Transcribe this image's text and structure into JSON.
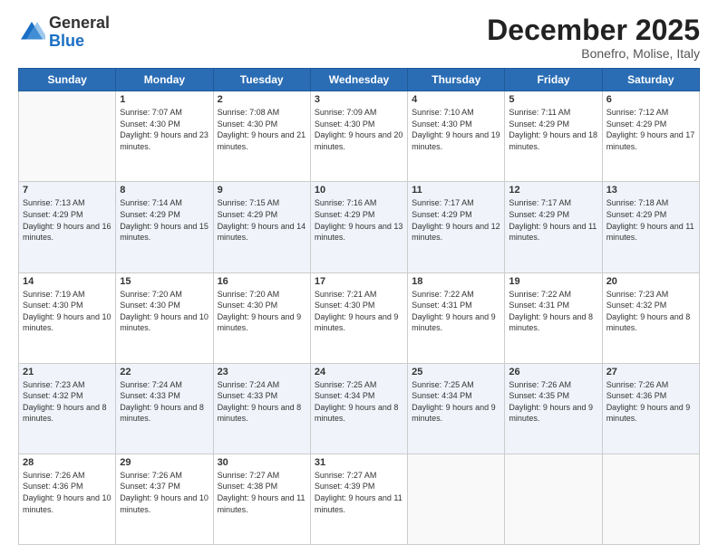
{
  "logo": {
    "general": "General",
    "blue": "Blue"
  },
  "header": {
    "month": "December 2025",
    "location": "Bonefro, Molise, Italy"
  },
  "weekdays": [
    "Sunday",
    "Monday",
    "Tuesday",
    "Wednesday",
    "Thursday",
    "Friday",
    "Saturday"
  ],
  "weeks": [
    [
      {
        "day": "",
        "sunrise": "",
        "sunset": "",
        "daylight": ""
      },
      {
        "day": "1",
        "sunrise": "Sunrise: 7:07 AM",
        "sunset": "Sunset: 4:30 PM",
        "daylight": "Daylight: 9 hours and 23 minutes."
      },
      {
        "day": "2",
        "sunrise": "Sunrise: 7:08 AM",
        "sunset": "Sunset: 4:30 PM",
        "daylight": "Daylight: 9 hours and 21 minutes."
      },
      {
        "day": "3",
        "sunrise": "Sunrise: 7:09 AM",
        "sunset": "Sunset: 4:30 PM",
        "daylight": "Daylight: 9 hours and 20 minutes."
      },
      {
        "day": "4",
        "sunrise": "Sunrise: 7:10 AM",
        "sunset": "Sunset: 4:30 PM",
        "daylight": "Daylight: 9 hours and 19 minutes."
      },
      {
        "day": "5",
        "sunrise": "Sunrise: 7:11 AM",
        "sunset": "Sunset: 4:29 PM",
        "daylight": "Daylight: 9 hours and 18 minutes."
      },
      {
        "day": "6",
        "sunrise": "Sunrise: 7:12 AM",
        "sunset": "Sunset: 4:29 PM",
        "daylight": "Daylight: 9 hours and 17 minutes."
      }
    ],
    [
      {
        "day": "7",
        "sunrise": "Sunrise: 7:13 AM",
        "sunset": "Sunset: 4:29 PM",
        "daylight": "Daylight: 9 hours and 16 minutes."
      },
      {
        "day": "8",
        "sunrise": "Sunrise: 7:14 AM",
        "sunset": "Sunset: 4:29 PM",
        "daylight": "Daylight: 9 hours and 15 minutes."
      },
      {
        "day": "9",
        "sunrise": "Sunrise: 7:15 AM",
        "sunset": "Sunset: 4:29 PM",
        "daylight": "Daylight: 9 hours and 14 minutes."
      },
      {
        "day": "10",
        "sunrise": "Sunrise: 7:16 AM",
        "sunset": "Sunset: 4:29 PM",
        "daylight": "Daylight: 9 hours and 13 minutes."
      },
      {
        "day": "11",
        "sunrise": "Sunrise: 7:17 AM",
        "sunset": "Sunset: 4:29 PM",
        "daylight": "Daylight: 9 hours and 12 minutes."
      },
      {
        "day": "12",
        "sunrise": "Sunrise: 7:17 AM",
        "sunset": "Sunset: 4:29 PM",
        "daylight": "Daylight: 9 hours and 11 minutes."
      },
      {
        "day": "13",
        "sunrise": "Sunrise: 7:18 AM",
        "sunset": "Sunset: 4:29 PM",
        "daylight": "Daylight: 9 hours and 11 minutes."
      }
    ],
    [
      {
        "day": "14",
        "sunrise": "Sunrise: 7:19 AM",
        "sunset": "Sunset: 4:30 PM",
        "daylight": "Daylight: 9 hours and 10 minutes."
      },
      {
        "day": "15",
        "sunrise": "Sunrise: 7:20 AM",
        "sunset": "Sunset: 4:30 PM",
        "daylight": "Daylight: 9 hours and 10 minutes."
      },
      {
        "day": "16",
        "sunrise": "Sunrise: 7:20 AM",
        "sunset": "Sunset: 4:30 PM",
        "daylight": "Daylight: 9 hours and 9 minutes."
      },
      {
        "day": "17",
        "sunrise": "Sunrise: 7:21 AM",
        "sunset": "Sunset: 4:30 PM",
        "daylight": "Daylight: 9 hours and 9 minutes."
      },
      {
        "day": "18",
        "sunrise": "Sunrise: 7:22 AM",
        "sunset": "Sunset: 4:31 PM",
        "daylight": "Daylight: 9 hours and 9 minutes."
      },
      {
        "day": "19",
        "sunrise": "Sunrise: 7:22 AM",
        "sunset": "Sunset: 4:31 PM",
        "daylight": "Daylight: 9 hours and 8 minutes."
      },
      {
        "day": "20",
        "sunrise": "Sunrise: 7:23 AM",
        "sunset": "Sunset: 4:32 PM",
        "daylight": "Daylight: 9 hours and 8 minutes."
      }
    ],
    [
      {
        "day": "21",
        "sunrise": "Sunrise: 7:23 AM",
        "sunset": "Sunset: 4:32 PM",
        "daylight": "Daylight: 9 hours and 8 minutes."
      },
      {
        "day": "22",
        "sunrise": "Sunrise: 7:24 AM",
        "sunset": "Sunset: 4:33 PM",
        "daylight": "Daylight: 9 hours and 8 minutes."
      },
      {
        "day": "23",
        "sunrise": "Sunrise: 7:24 AM",
        "sunset": "Sunset: 4:33 PM",
        "daylight": "Daylight: 9 hours and 8 minutes."
      },
      {
        "day": "24",
        "sunrise": "Sunrise: 7:25 AM",
        "sunset": "Sunset: 4:34 PM",
        "daylight": "Daylight: 9 hours and 8 minutes."
      },
      {
        "day": "25",
        "sunrise": "Sunrise: 7:25 AM",
        "sunset": "Sunset: 4:34 PM",
        "daylight": "Daylight: 9 hours and 9 minutes."
      },
      {
        "day": "26",
        "sunrise": "Sunrise: 7:26 AM",
        "sunset": "Sunset: 4:35 PM",
        "daylight": "Daylight: 9 hours and 9 minutes."
      },
      {
        "day": "27",
        "sunrise": "Sunrise: 7:26 AM",
        "sunset": "Sunset: 4:36 PM",
        "daylight": "Daylight: 9 hours and 9 minutes."
      }
    ],
    [
      {
        "day": "28",
        "sunrise": "Sunrise: 7:26 AM",
        "sunset": "Sunset: 4:36 PM",
        "daylight": "Daylight: 9 hours and 10 minutes."
      },
      {
        "day": "29",
        "sunrise": "Sunrise: 7:26 AM",
        "sunset": "Sunset: 4:37 PM",
        "daylight": "Daylight: 9 hours and 10 minutes."
      },
      {
        "day": "30",
        "sunrise": "Sunrise: 7:27 AM",
        "sunset": "Sunset: 4:38 PM",
        "daylight": "Daylight: 9 hours and 11 minutes."
      },
      {
        "day": "31",
        "sunrise": "Sunrise: 7:27 AM",
        "sunset": "Sunset: 4:39 PM",
        "daylight": "Daylight: 9 hours and 11 minutes."
      },
      {
        "day": "",
        "sunrise": "",
        "sunset": "",
        "daylight": ""
      },
      {
        "day": "",
        "sunrise": "",
        "sunset": "",
        "daylight": ""
      },
      {
        "day": "",
        "sunrise": "",
        "sunset": "",
        "daylight": ""
      }
    ]
  ]
}
